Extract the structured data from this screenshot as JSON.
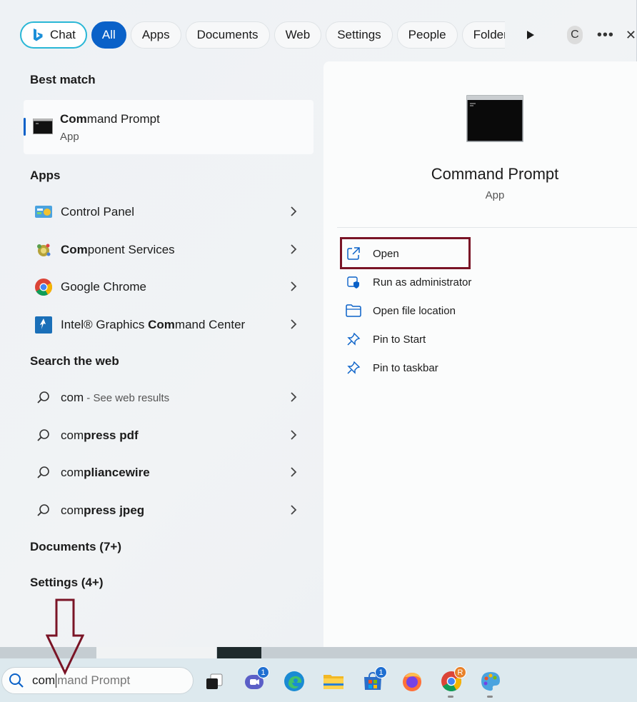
{
  "filters": {
    "chat": "Chat",
    "all": "All",
    "apps": "Apps",
    "documents": "Documents",
    "web": "Web",
    "settings": "Settings",
    "people": "People",
    "folders": "Folders",
    "avatar_letter": "C",
    "more": "•••"
  },
  "best_match": {
    "heading": "Best match",
    "title_bold": "Com",
    "title_rest": "mand Prompt",
    "subtitle": "App"
  },
  "apps": {
    "heading": "Apps",
    "items": [
      {
        "pre": "",
        "bold": "",
        "post": "Control Panel"
      },
      {
        "pre": "",
        "bold": "Com",
        "post": "ponent Services"
      },
      {
        "pre": "Google Chrome",
        "bold": "",
        "post": ""
      },
      {
        "pre": "Intel® Graphics ",
        "bold": "Com",
        "post": "mand Center"
      }
    ]
  },
  "web": {
    "heading": "Search the web",
    "items": [
      {
        "pre": "com",
        "bold": "",
        "dim": " - See web results"
      },
      {
        "pre": "com",
        "bold": "press pdf",
        "dim": ""
      },
      {
        "pre": "com",
        "bold": "pliancewire",
        "dim": ""
      },
      {
        "pre": "com",
        "bold": "press jpeg",
        "dim": ""
      }
    ]
  },
  "documents_heading": "Documents (7+)",
  "settings_heading": "Settings (4+)",
  "detail": {
    "name": "Command Prompt",
    "type": "App",
    "actions": [
      "Open",
      "Run as administrator",
      "Open file location",
      "Pin to Start",
      "Pin to taskbar"
    ]
  },
  "taskbar": {
    "search_typed": "com",
    "search_ghost": "mand Prompt",
    "teams_badge": "1",
    "store_badge": "1",
    "chrome_badge": "R"
  },
  "colors": {
    "accent": "#0a61c8",
    "highlight": "#7a1426",
    "chat_border": "#2ab7d6"
  }
}
